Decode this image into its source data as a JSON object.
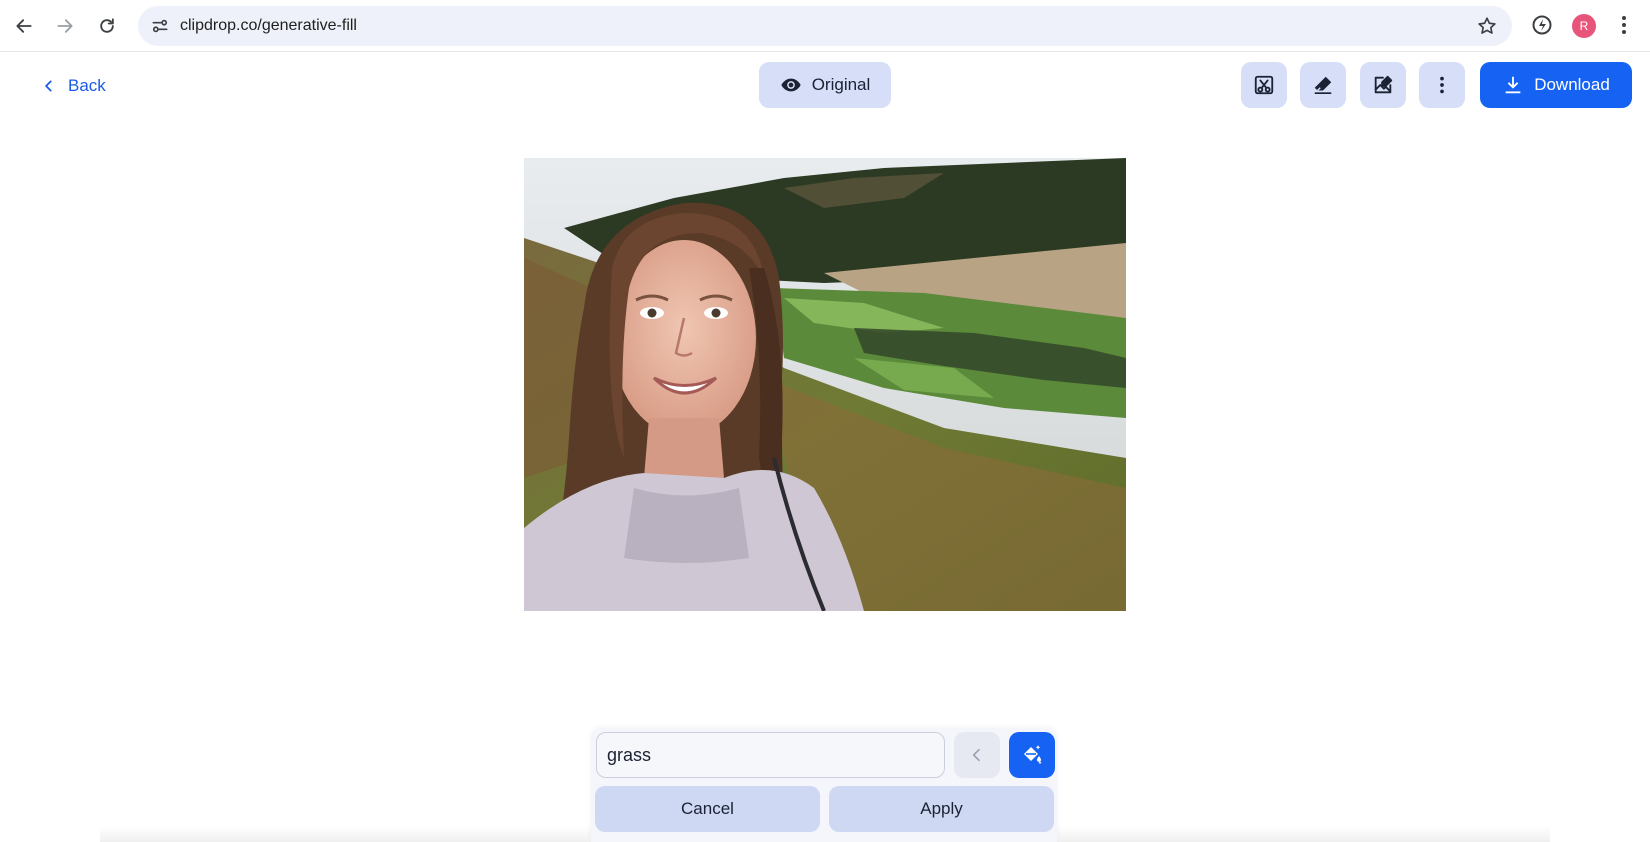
{
  "browser": {
    "url": "clipdrop.co/generative-fill",
    "avatar_initial": "R",
    "icons": {
      "back": "arrow-left-icon",
      "forward": "arrow-right-icon",
      "reload": "reload-icon",
      "site_info": "tune-icon",
      "bookmark": "star-icon",
      "extension": "extension-icon",
      "menu": "kebab-menu-icon"
    }
  },
  "header": {
    "back_label": "Back",
    "original_label": "Original",
    "tools": [
      "scissors-tool-icon",
      "eraser-tool-icon",
      "edit-image-icon",
      "more-options-icon"
    ],
    "download_label": "Download"
  },
  "image": {
    "description_icon": "photo"
  },
  "prompt": {
    "value": "grass",
    "cancel_label": "Cancel",
    "apply_label": "Apply"
  },
  "colors": {
    "accent": "#1663f3",
    "button_bg": "#d6def8",
    "link": "#1a5ae6"
  }
}
